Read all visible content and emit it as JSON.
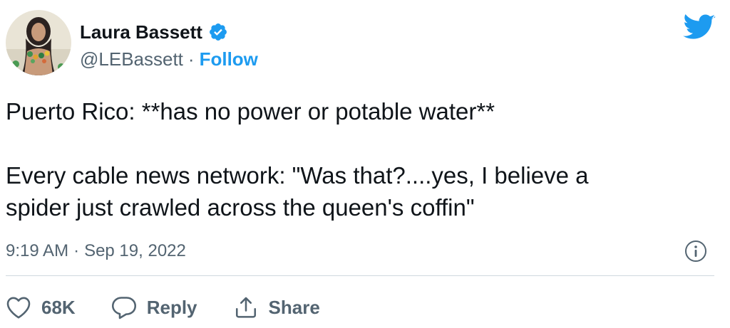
{
  "user": {
    "display_name": "Laura Bassett",
    "handle": "@LEBassett",
    "separator": "·",
    "follow_label": "Follow",
    "verified_icon": "verified-badge-icon",
    "avatar_icon": "profile-photo"
  },
  "brand": {
    "logo_icon": "twitter-bird-icon",
    "accent_color": "#1d9bf0"
  },
  "tweet": {
    "lines": [
      "Puerto Rico: **has no power or potable water**",
      "",
      "Every cable news network: \"Was that?....yes, I believe a",
      "spider just crawled across the queen's coffin\""
    ],
    "time": "9:19 AM",
    "separator": "·",
    "date": "Sep 19, 2022",
    "info_icon": "info-icon"
  },
  "actions": {
    "like_icon": "heart-icon",
    "like_count": "68K",
    "reply_icon": "reply-bubble-icon",
    "reply_label": "Reply",
    "share_icon": "share-icon",
    "share_label": "Share"
  },
  "colors": {
    "text_primary": "#0f1419",
    "text_secondary": "#536471",
    "divider": "#cfd9de"
  }
}
